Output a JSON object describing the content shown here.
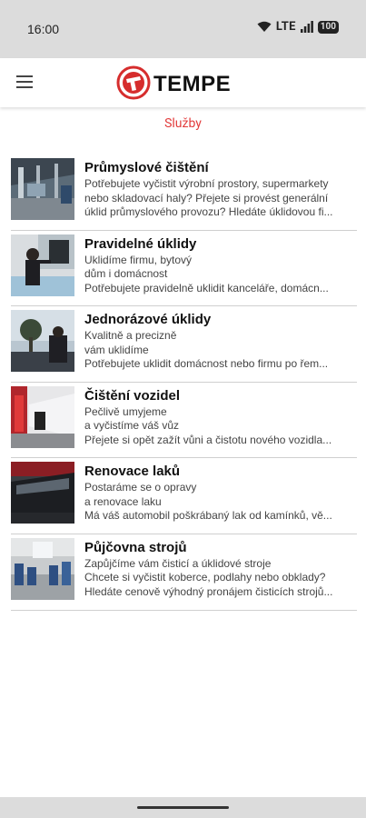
{
  "status_bar": {
    "time": "16:00",
    "network": "LTE",
    "battery": "100"
  },
  "header": {
    "brand": "TEMPE",
    "menu_icon": "hamburger-menu-icon"
  },
  "section_title": "Služby",
  "colors": {
    "accent": "#e23b3b",
    "status_bar_bg": "#dcdcdc"
  },
  "services": [
    {
      "title": "Průmyslové čištění",
      "lines": [
        "Potřebujete vyčistit výrobní prostory, supermarkety",
        "nebo skladovací haly? Přejete si provést generální",
        "úklid průmyslového provozu? Hledáte úklidovou fi..."
      ]
    },
    {
      "title": "Pravidelné úklidy",
      "lines": [
        "Uklidíme firmu, bytový",
        "dům i domácnost",
        "Potřebujete pravidelně uklidit kanceláře, domácn..."
      ]
    },
    {
      "title": "Jednorázové úklidy",
      "lines": [
        "Kvalitně a precizně",
        "vám uklidíme",
        "Potřebujete uklidit domácnost nebo firmu po řem..."
      ]
    },
    {
      "title": "Čištění vozidel",
      "lines": [
        "Pečlivě umyjeme",
        "a vyčistíme váš vůz",
        "Přejete si opět zažít vůni a čistotu nového vozidla..."
      ]
    },
    {
      "title": "Renovace laků",
      "lines": [
        "Postaráme se o opravy",
        "a renovace laku",
        "Má váš automobil poškrábaný lak od kamínků, vě..."
      ]
    },
    {
      "title": "Půjčovna strojů",
      "lines": [
        "Zapůjčíme vám čisticí a úklidové stroje",
        "Chcete si vyčistit koberce, podlahy nebo obklady?",
        "Hledáte cenově výhodný pronájem čisticích strojů..."
      ]
    }
  ]
}
